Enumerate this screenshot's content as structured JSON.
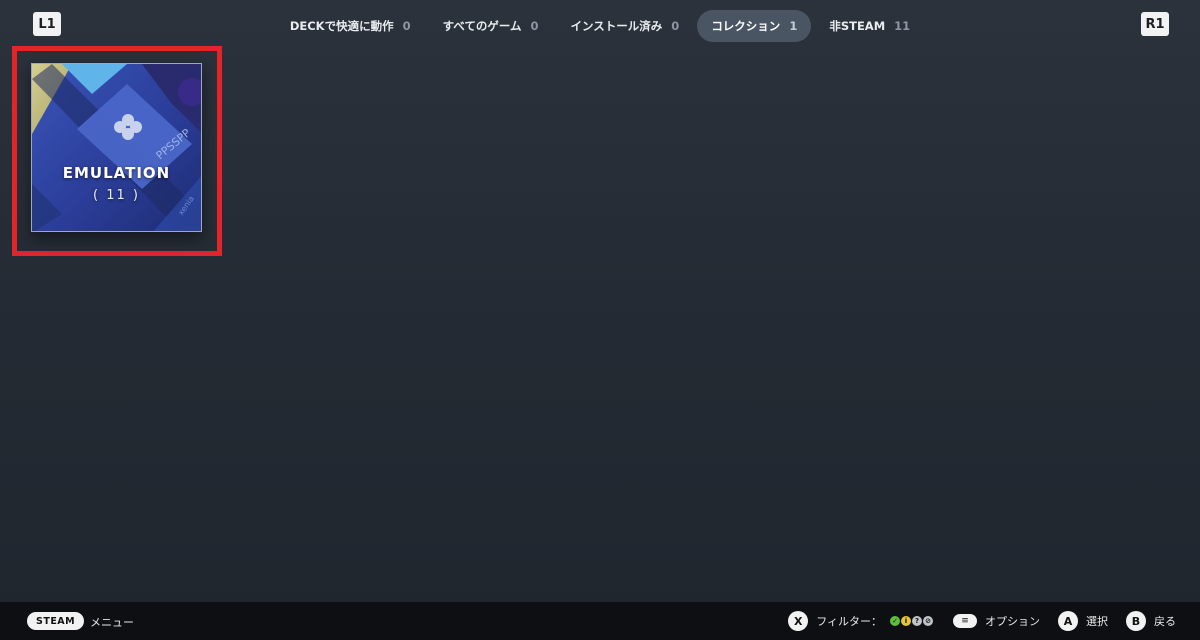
{
  "shoulders": {
    "left": "L1",
    "right": "R1"
  },
  "tabs": [
    {
      "label": "DECKで快適に動作",
      "count": "0",
      "active": false
    },
    {
      "label": "すべてのゲーム",
      "count": "0",
      "active": false
    },
    {
      "label": "インストール済み",
      "count": "0",
      "active": false
    },
    {
      "label": "コレクション",
      "count": "1",
      "active": true
    },
    {
      "label": "非STEAM",
      "count": "11",
      "active": false
    }
  ],
  "collection": {
    "title": "EMULATION",
    "count": "( 11 )",
    "art_texts": {
      "ppsspp": "PPSSPP",
      "xenia": "xenia"
    },
    "highlight_color": "#e3242b"
  },
  "footer": {
    "steam_label": "STEAM",
    "menu_label": "メニュー",
    "filter_button": "X",
    "filter_label": "フィルター：",
    "filter_icons": [
      {
        "name": "verified-icon",
        "color": "#5fbf3a",
        "glyph": "✓"
      },
      {
        "name": "playable-icon",
        "color": "#e8c43a",
        "glyph": "i"
      },
      {
        "name": "unknown-icon",
        "color": "#bfc4ca",
        "glyph": "?"
      },
      {
        "name": "unsupported-icon",
        "color": "#bfc4ca",
        "glyph": "⊘"
      }
    ],
    "options_button": "≡",
    "options_label": "オプション",
    "select_button": "A",
    "select_label": "選択",
    "back_button": "B",
    "back_label": "戻る"
  }
}
